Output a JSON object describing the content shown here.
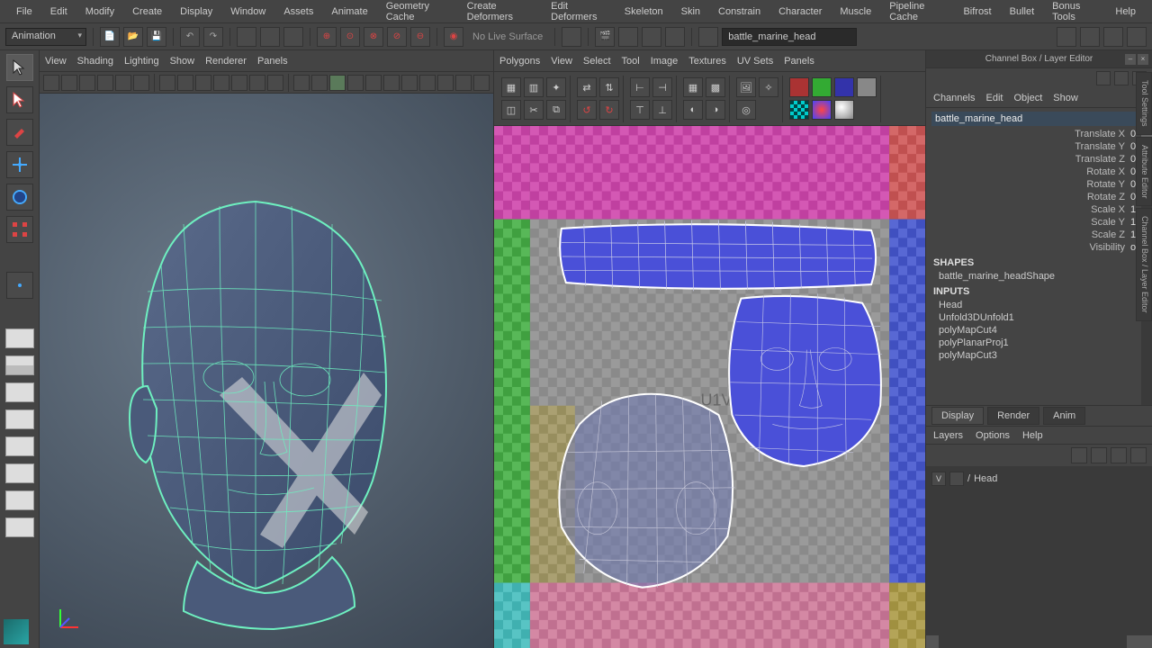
{
  "menubar": [
    "File",
    "Edit",
    "Modify",
    "Create",
    "Display",
    "Window",
    "Assets",
    "Animate",
    "Geometry Cache",
    "Create Deformers",
    "Edit Deformers",
    "Skeleton",
    "Skin",
    "Constrain",
    "Character",
    "Muscle",
    "Pipeline Cache",
    "Bifrost",
    "Bullet",
    "Bonus Tools",
    "Help"
  ],
  "shelf": {
    "mode": "Animation",
    "surface_label": "No Live Surface",
    "object_name": "battle_marine_head"
  },
  "viewport_panel_menu": [
    "View",
    "Shading",
    "Lighting",
    "Show",
    "Renderer",
    "Panels"
  ],
  "uv_panel_menu": [
    "Polygons",
    "View",
    "Select",
    "Tool",
    "Image",
    "Textures",
    "UV Sets",
    "Panels"
  ],
  "uv_label": "U1V1",
  "channel_box": {
    "title": "Channel Box / Layer Editor",
    "tabs": [
      "Channels",
      "Edit",
      "Object",
      "Show"
    ],
    "object": "battle_marine_head",
    "attrs": [
      {
        "label": "Translate X",
        "val": "0"
      },
      {
        "label": "Translate Y",
        "val": "0"
      },
      {
        "label": "Translate Z",
        "val": "0"
      },
      {
        "label": "Rotate X",
        "val": "0"
      },
      {
        "label": "Rotate Y",
        "val": "0"
      },
      {
        "label": "Rotate Z",
        "val": "0"
      },
      {
        "label": "Scale X",
        "val": "1"
      },
      {
        "label": "Scale Y",
        "val": "1"
      },
      {
        "label": "Scale Z",
        "val": "1"
      },
      {
        "label": "Visibility",
        "val": "on"
      }
    ],
    "shapes_header": "SHAPES",
    "shape": "battle_marine_headShape",
    "inputs_header": "INPUTS",
    "inputs": [
      "Head",
      "Unfold3DUnfold1",
      "polyMapCut4",
      "polyPlanarProj1",
      "polyMapCut3"
    ]
  },
  "render_tabs": [
    "Display",
    "Render",
    "Anim"
  ],
  "layer_menu": [
    "Layers",
    "Options",
    "Help"
  ],
  "layer": {
    "vis": "V",
    "slash": "/",
    "name": "Head"
  },
  "side_tabs": [
    "Tool Settings",
    "Attribute Editor",
    "Channel Box / Layer Editor"
  ]
}
